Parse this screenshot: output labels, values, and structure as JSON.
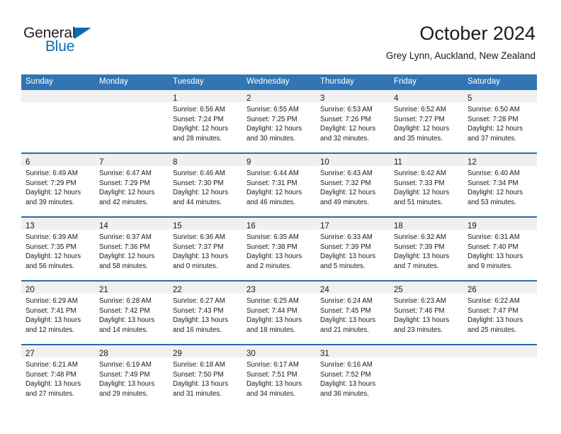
{
  "brand": {
    "name_part1": "General",
    "name_part2": "Blue",
    "accent_color": "#0a6cb4"
  },
  "header": {
    "title": "October 2024",
    "subtitle": "Grey Lynn, Auckland, New Zealand"
  },
  "theme": {
    "header_blue": "#3275b4",
    "row_divider_blue": "#2a6ba8",
    "daynum_band": "#f0f0f0"
  },
  "weekdays": [
    "Sunday",
    "Monday",
    "Tuesday",
    "Wednesday",
    "Thursday",
    "Friday",
    "Saturday"
  ],
  "weeks": [
    [
      {
        "day": "",
        "lines": []
      },
      {
        "day": "",
        "lines": []
      },
      {
        "day": "1",
        "lines": [
          "Sunrise: 6:56 AM",
          "Sunset: 7:24 PM",
          "Daylight: 12 hours",
          "and 28 minutes."
        ]
      },
      {
        "day": "2",
        "lines": [
          "Sunrise: 6:55 AM",
          "Sunset: 7:25 PM",
          "Daylight: 12 hours",
          "and 30 minutes."
        ]
      },
      {
        "day": "3",
        "lines": [
          "Sunrise: 6:53 AM",
          "Sunset: 7:26 PM",
          "Daylight: 12 hours",
          "and 32 minutes."
        ]
      },
      {
        "day": "4",
        "lines": [
          "Sunrise: 6:52 AM",
          "Sunset: 7:27 PM",
          "Daylight: 12 hours",
          "and 35 minutes."
        ]
      },
      {
        "day": "5",
        "lines": [
          "Sunrise: 6:50 AM",
          "Sunset: 7:28 PM",
          "Daylight: 12 hours",
          "and 37 minutes."
        ]
      }
    ],
    [
      {
        "day": "6",
        "lines": [
          "Sunrise: 6:49 AM",
          "Sunset: 7:29 PM",
          "Daylight: 12 hours",
          "and 39 minutes."
        ]
      },
      {
        "day": "7",
        "lines": [
          "Sunrise: 6:47 AM",
          "Sunset: 7:29 PM",
          "Daylight: 12 hours",
          "and 42 minutes."
        ]
      },
      {
        "day": "8",
        "lines": [
          "Sunrise: 6:46 AM",
          "Sunset: 7:30 PM",
          "Daylight: 12 hours",
          "and 44 minutes."
        ]
      },
      {
        "day": "9",
        "lines": [
          "Sunrise: 6:44 AM",
          "Sunset: 7:31 PM",
          "Daylight: 12 hours",
          "and 46 minutes."
        ]
      },
      {
        "day": "10",
        "lines": [
          "Sunrise: 6:43 AM",
          "Sunset: 7:32 PM",
          "Daylight: 12 hours",
          "and 49 minutes."
        ]
      },
      {
        "day": "11",
        "lines": [
          "Sunrise: 6:42 AM",
          "Sunset: 7:33 PM",
          "Daylight: 12 hours",
          "and 51 minutes."
        ]
      },
      {
        "day": "12",
        "lines": [
          "Sunrise: 6:40 AM",
          "Sunset: 7:34 PM",
          "Daylight: 12 hours",
          "and 53 minutes."
        ]
      }
    ],
    [
      {
        "day": "13",
        "lines": [
          "Sunrise: 6:39 AM",
          "Sunset: 7:35 PM",
          "Daylight: 12 hours",
          "and 56 minutes."
        ]
      },
      {
        "day": "14",
        "lines": [
          "Sunrise: 6:37 AM",
          "Sunset: 7:36 PM",
          "Daylight: 12 hours",
          "and 58 minutes."
        ]
      },
      {
        "day": "15",
        "lines": [
          "Sunrise: 6:36 AM",
          "Sunset: 7:37 PM",
          "Daylight: 13 hours",
          "and 0 minutes."
        ]
      },
      {
        "day": "16",
        "lines": [
          "Sunrise: 6:35 AM",
          "Sunset: 7:38 PM",
          "Daylight: 13 hours",
          "and 2 minutes."
        ]
      },
      {
        "day": "17",
        "lines": [
          "Sunrise: 6:33 AM",
          "Sunset: 7:39 PM",
          "Daylight: 13 hours",
          "and 5 minutes."
        ]
      },
      {
        "day": "18",
        "lines": [
          "Sunrise: 6:32 AM",
          "Sunset: 7:39 PM",
          "Daylight: 13 hours",
          "and 7 minutes."
        ]
      },
      {
        "day": "19",
        "lines": [
          "Sunrise: 6:31 AM",
          "Sunset: 7:40 PM",
          "Daylight: 13 hours",
          "and 9 minutes."
        ]
      }
    ],
    [
      {
        "day": "20",
        "lines": [
          "Sunrise: 6:29 AM",
          "Sunset: 7:41 PM",
          "Daylight: 13 hours",
          "and 12 minutes."
        ]
      },
      {
        "day": "21",
        "lines": [
          "Sunrise: 6:28 AM",
          "Sunset: 7:42 PM",
          "Daylight: 13 hours",
          "and 14 minutes."
        ]
      },
      {
        "day": "22",
        "lines": [
          "Sunrise: 6:27 AM",
          "Sunset: 7:43 PM",
          "Daylight: 13 hours",
          "and 16 minutes."
        ]
      },
      {
        "day": "23",
        "lines": [
          "Sunrise: 6:25 AM",
          "Sunset: 7:44 PM",
          "Daylight: 13 hours",
          "and 18 minutes."
        ]
      },
      {
        "day": "24",
        "lines": [
          "Sunrise: 6:24 AM",
          "Sunset: 7:45 PM",
          "Daylight: 13 hours",
          "and 21 minutes."
        ]
      },
      {
        "day": "25",
        "lines": [
          "Sunrise: 6:23 AM",
          "Sunset: 7:46 PM",
          "Daylight: 13 hours",
          "and 23 minutes."
        ]
      },
      {
        "day": "26",
        "lines": [
          "Sunrise: 6:22 AM",
          "Sunset: 7:47 PM",
          "Daylight: 13 hours",
          "and 25 minutes."
        ]
      }
    ],
    [
      {
        "day": "27",
        "lines": [
          "Sunrise: 6:21 AM",
          "Sunset: 7:48 PM",
          "Daylight: 13 hours",
          "and 27 minutes."
        ]
      },
      {
        "day": "28",
        "lines": [
          "Sunrise: 6:19 AM",
          "Sunset: 7:49 PM",
          "Daylight: 13 hours",
          "and 29 minutes."
        ]
      },
      {
        "day": "29",
        "lines": [
          "Sunrise: 6:18 AM",
          "Sunset: 7:50 PM",
          "Daylight: 13 hours",
          "and 31 minutes."
        ]
      },
      {
        "day": "30",
        "lines": [
          "Sunrise: 6:17 AM",
          "Sunset: 7:51 PM",
          "Daylight: 13 hours",
          "and 34 minutes."
        ]
      },
      {
        "day": "31",
        "lines": [
          "Sunrise: 6:16 AM",
          "Sunset: 7:52 PM",
          "Daylight: 13 hours",
          "and 36 minutes."
        ]
      },
      {
        "day": "",
        "lines": []
      },
      {
        "day": "",
        "lines": []
      }
    ]
  ]
}
